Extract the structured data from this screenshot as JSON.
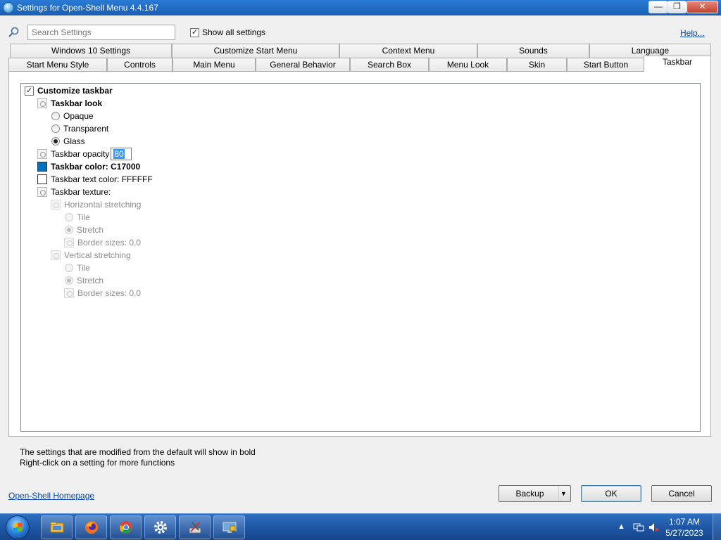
{
  "window": {
    "title": "Settings for Open-Shell Menu 4.4.167",
    "minimize": "—",
    "maximize": "❐",
    "close": "✕"
  },
  "toolbar": {
    "search_placeholder": "Search Settings",
    "show_all_label": "Show all settings",
    "show_all_checked": true,
    "help_label": "Help..."
  },
  "tabs_row1": [
    {
      "label": "Windows 10 Settings"
    },
    {
      "label": "Customize Start Menu"
    },
    {
      "label": "Context Menu"
    },
    {
      "label": "Sounds"
    },
    {
      "label": "Language"
    }
  ],
  "tabs_row2": [
    {
      "label": "Start Menu Style"
    },
    {
      "label": "Controls"
    },
    {
      "label": "Main Menu"
    },
    {
      "label": "General Behavior"
    },
    {
      "label": "Search Box"
    },
    {
      "label": "Menu Look"
    },
    {
      "label": "Skin"
    },
    {
      "label": "Start Button"
    },
    {
      "label": "Taskbar",
      "active": true
    }
  ],
  "settings": {
    "customize_taskbar": "Customize taskbar",
    "taskbar_look": "Taskbar look",
    "opaque": "Opaque",
    "transparent": "Transparent",
    "glass": "Glass",
    "taskbar_opacity": "Taskbar opacity",
    "opacity_value": "80",
    "taskbar_color": "Taskbar color: C17000",
    "taskbar_color_swatch": "#0070C1",
    "taskbar_text_color": "Taskbar text color: FFFFFF",
    "taskbar_text_swatch": "#FFFFFF",
    "taskbar_texture": "Taskbar texture:",
    "horizontal_stretching": "Horizontal stretching",
    "h_tile": "Tile",
    "h_stretch": "Stretch",
    "h_border": "Border sizes: 0,0",
    "vertical_stretching": "Vertical stretching",
    "v_tile": "Tile",
    "v_stretch": "Stretch",
    "v_border": "Border sizes: 0,0"
  },
  "hints": {
    "bold_note": "The settings that are modified from the default will show in bold",
    "right_click_note": "Right-click on a setting for more functions"
  },
  "footer": {
    "homepage_link": "Open-Shell Homepage",
    "backup_label": "Backup",
    "ok_label": "OK",
    "cancel_label": "Cancel"
  },
  "taskbar": {
    "time": "1:07 AM",
    "date": "5/27/2023",
    "apps": [
      "file-explorer",
      "firefox",
      "chrome",
      "settings-gear",
      "tools",
      "remote-desktop"
    ]
  },
  "colors": {
    "title_bar": "#1a5fb4",
    "taskbar": "#1c53a0",
    "link": "#0645ad"
  }
}
